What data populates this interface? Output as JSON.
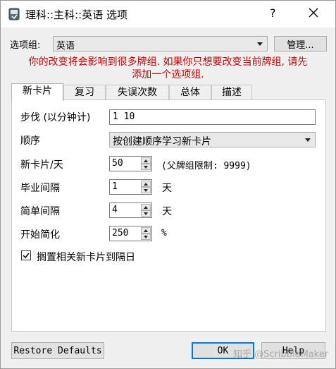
{
  "window": {
    "title": "理科::主科::英语 选项",
    "help_glyph": "?",
    "close_glyph": "✕"
  },
  "options_group": {
    "label": "选项组:",
    "value": "英语",
    "manage_label": "管理..."
  },
  "warning": {
    "line1": "你的改变将会影响到很多牌组. 如果你只想要改变当前牌组, 请先",
    "line2": "添加一个选项组."
  },
  "tabs": [
    "新卡片",
    "复习",
    "失误次数",
    "总体",
    "描述"
  ],
  "new_cards": {
    "steps_label": "步伐 (以分钟计)",
    "steps_value": "1 10",
    "order_label": "顺序",
    "order_value": "按创建顺序学习新卡片",
    "per_day_label": "新卡片/天",
    "per_day_value": "50",
    "per_day_note": "(父牌组限制: 9999)",
    "graduating_label": "毕业间隔",
    "graduating_value": "1",
    "graduating_unit": "天",
    "easy_label": "简单间隔",
    "easy_value": "4",
    "easy_unit": "天",
    "ease_label": "开始简化",
    "ease_value": "250",
    "ease_unit": "%",
    "bury_label": "搁置相关新卡片到隔日",
    "bury_checked": true
  },
  "footer": {
    "restore_label": "Restore Defaults",
    "ok_label": "OK",
    "help_label": "Help"
  },
  "watermark": "知乎 @ScribbleMaker"
}
